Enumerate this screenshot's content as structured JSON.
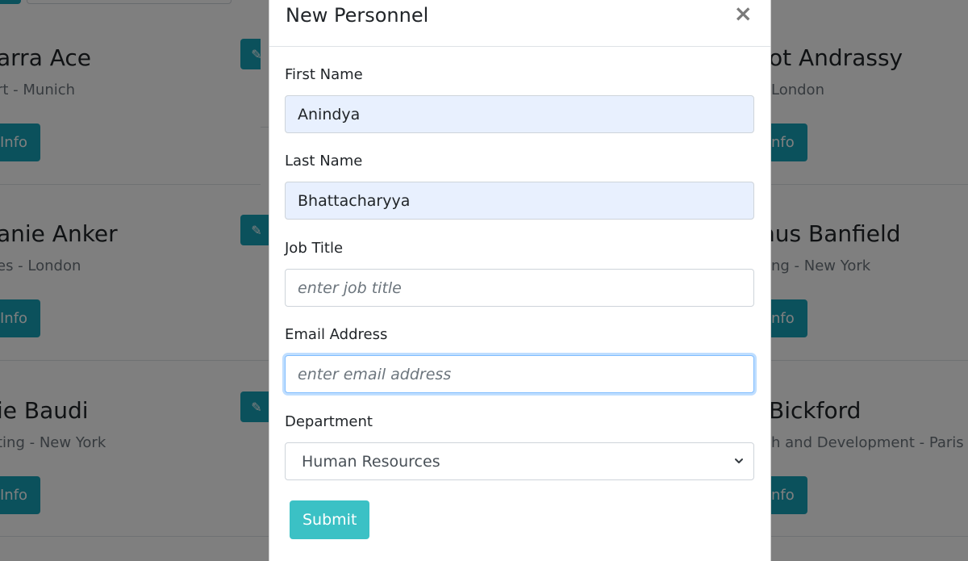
{
  "background": {
    "cards": [
      {
        "name": "arra Ace",
        "sub": "rt - Munich",
        "info": "Info"
      },
      {
        "name": "ot Andrassy",
        "sub": " London",
        "info": "nfo"
      },
      {
        "name": "anie Anker",
        "sub": "es - London",
        "info": "Info"
      },
      {
        "name": "hus Banfield",
        "sub": "ng - New York",
        "info": "nfo"
      },
      {
        "name": "ie Baudi",
        "sub": "ting - New York",
        "info": "Info"
      },
      {
        "name": "Bickford",
        "sub": "h and Development - Paris",
        "info": "nfo"
      }
    ],
    "edit_icon": "pencil-icon"
  },
  "modal": {
    "title": "New Personnel",
    "close_label": "×",
    "fields": {
      "first_name": {
        "label": "First Name",
        "value": "Anindya"
      },
      "last_name": {
        "label": "Last Name",
        "value": "Bhattacharyya"
      },
      "job_title": {
        "label": "Job Title",
        "value": "",
        "placeholder": "enter job title"
      },
      "email": {
        "label": "Email Address",
        "value": "",
        "placeholder": "enter email address"
      },
      "department": {
        "label": "Department",
        "selected": "Human Resources"
      }
    },
    "submit_label": "Submit"
  },
  "colors": {
    "accent": "#17a2b8",
    "submit": "#3bc1c5",
    "autofill_bg": "#e8f0fe",
    "focus_border": "#80bdff"
  }
}
